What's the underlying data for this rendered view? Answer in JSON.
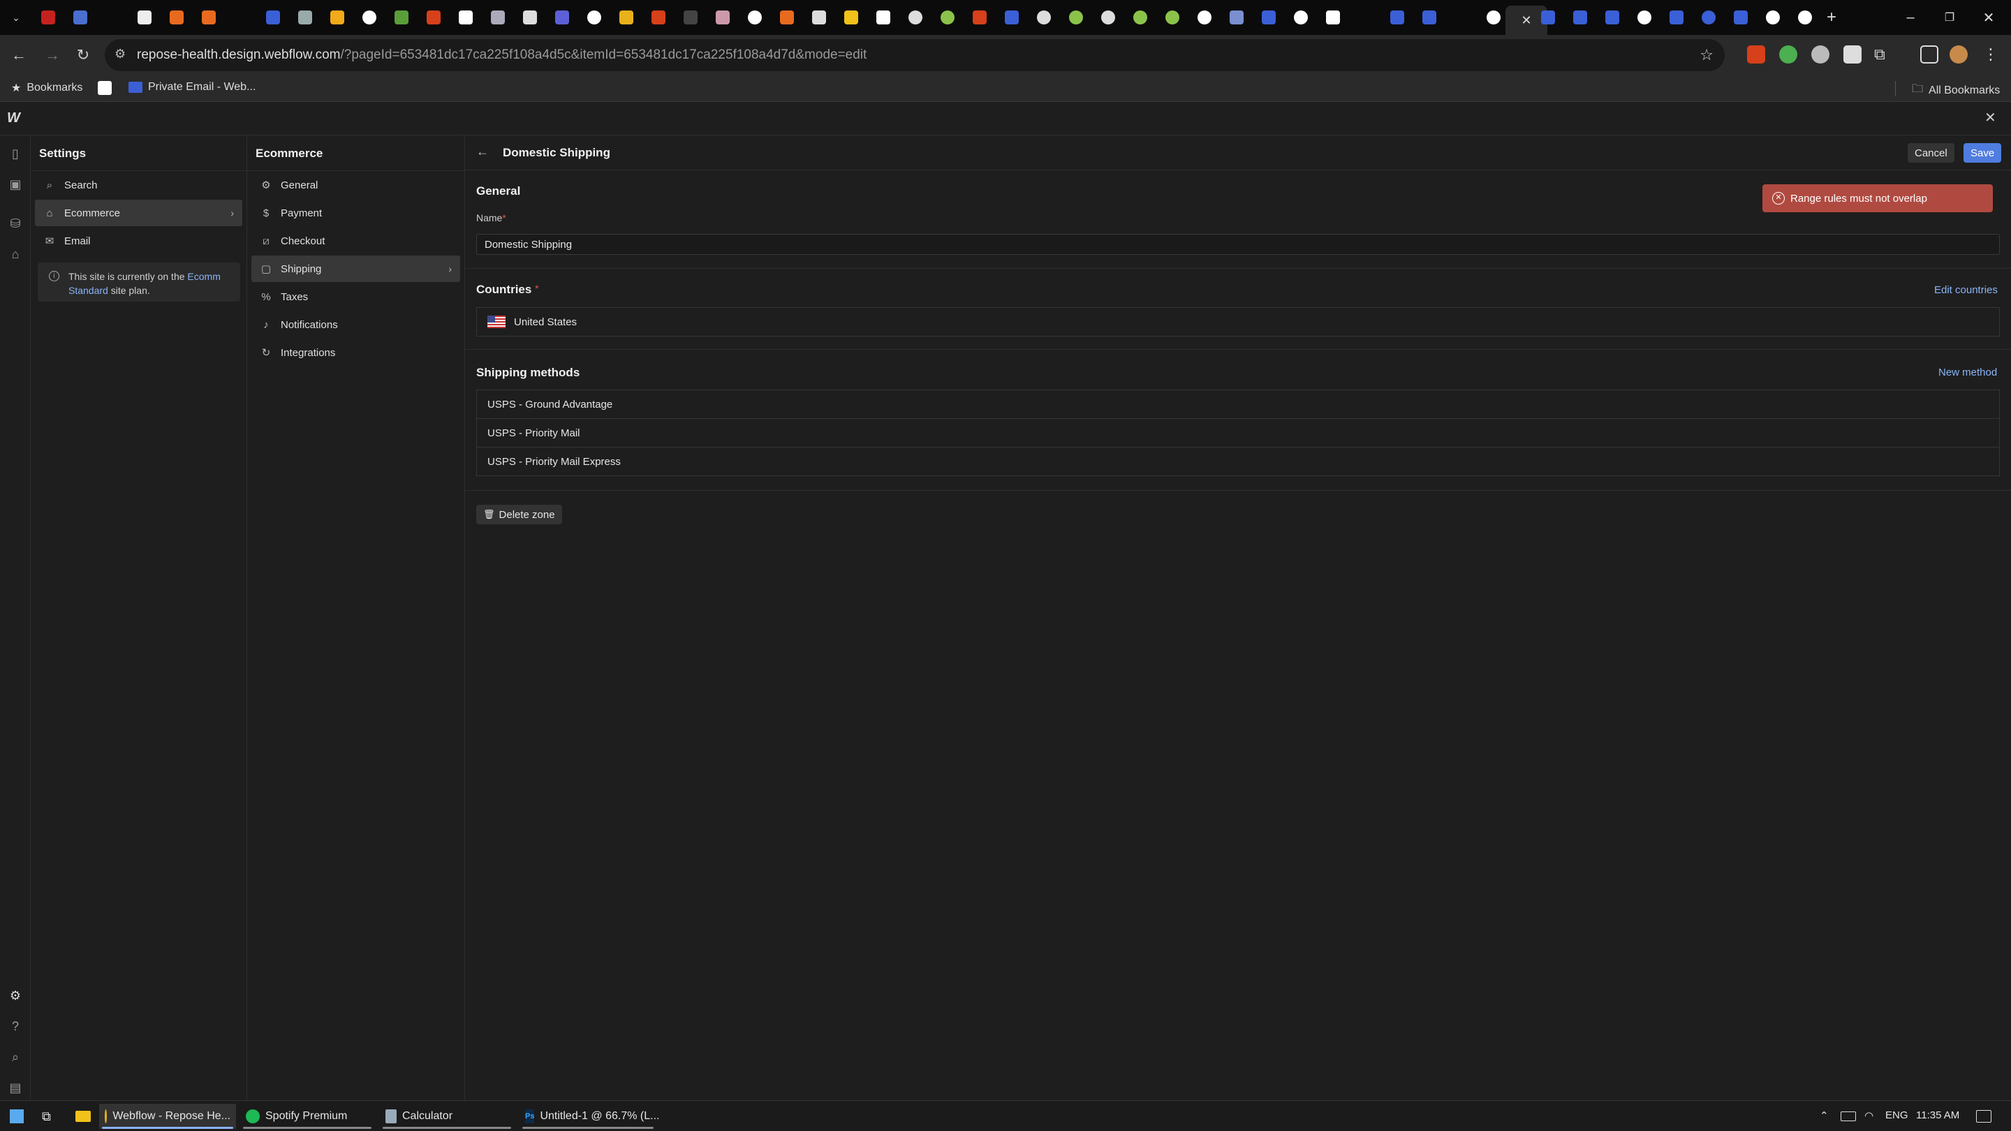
{
  "browser": {
    "url_host": "repose-health.design.webflow.com",
    "url_path": "/?pageId=653481dc17ca225f108a4d5c&itemId=653481dc17ca225f108a4d7d&mode=edit",
    "bookmarks": {
      "bookmarks_label": "Bookmarks",
      "private_email": "Private Email - Web...",
      "all_bookmarks": "All Bookmarks"
    }
  },
  "settings": {
    "title": "Settings",
    "items": [
      {
        "label": "Search",
        "icon": "search-icon"
      },
      {
        "label": "Ecommerce",
        "icon": "basket-icon"
      },
      {
        "label": "Email",
        "icon": "mail-icon"
      }
    ],
    "plan_notice": {
      "prefix": "This site is currently on the",
      "link": "Ecomm Standard",
      "suffix": "site plan."
    }
  },
  "ecommerce": {
    "title": "Ecommerce",
    "items": [
      {
        "label": "General",
        "icon": "gear-icon"
      },
      {
        "label": "Payment",
        "icon": "dollar-icon"
      },
      {
        "label": "Checkout",
        "icon": "checkout-icon"
      },
      {
        "label": "Shipping",
        "icon": "box-icon"
      },
      {
        "label": "Taxes",
        "icon": "percent-icon"
      },
      {
        "label": "Notifications",
        "icon": "bell-icon"
      },
      {
        "label": "Integrations",
        "icon": "integrations-icon"
      }
    ]
  },
  "zone": {
    "title": "Domestic Shipping",
    "cancel_label": "Cancel",
    "save_label": "Save",
    "general_title": "General",
    "name_label": "Name",
    "name_value": "Domestic Shipping",
    "countries_title": "Countries",
    "edit_countries": "Edit countries",
    "country": "United States",
    "methods_title": "Shipping methods",
    "new_method": "New method",
    "methods": [
      "USPS - Ground Advantage",
      "USPS - Priority Mail",
      "USPS - Priority Mail Express"
    ],
    "delete_label": "Delete zone"
  },
  "toast": {
    "message": "Range rules must not overlap"
  },
  "taskbar": {
    "apps": [
      {
        "label": "Webflow - Repose He...",
        "icon": "chrome-icon"
      },
      {
        "label": "Spotify Premium",
        "icon": "spotify-icon"
      },
      {
        "label": "Calculator",
        "icon": "calculator-icon"
      },
      {
        "label": "Untitled-1 @ 66.7% (L...",
        "icon": "photoshop-icon"
      }
    ],
    "language": "ENG",
    "time": "11:35 AM"
  },
  "colors": {
    "accent": "#4f7de0",
    "toast": "#b04a41",
    "link": "#8ab4f8"
  }
}
